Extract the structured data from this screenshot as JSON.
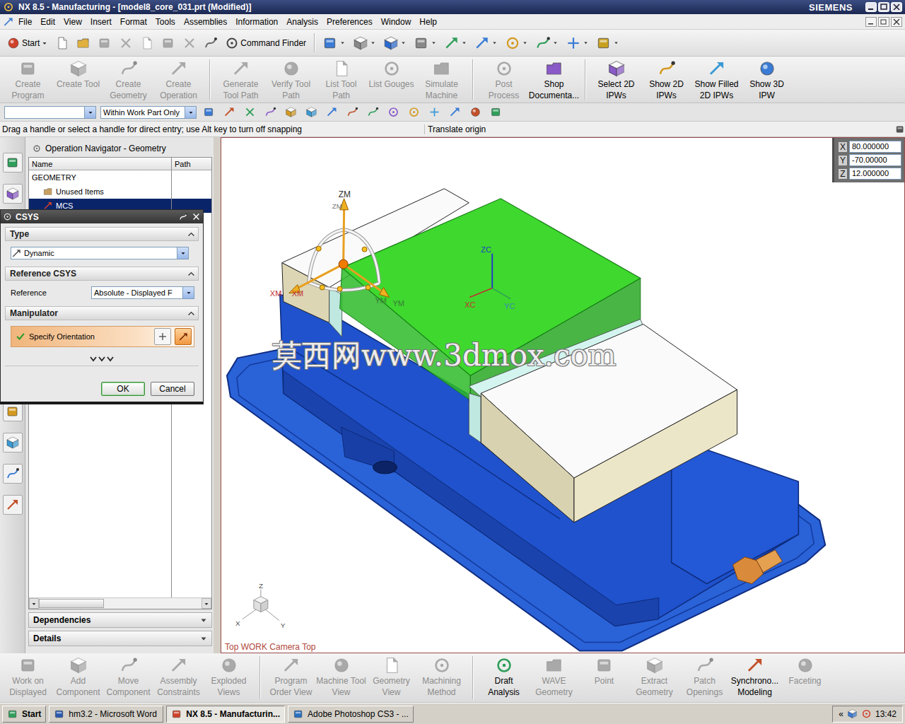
{
  "window": {
    "title": "NX 8.5 - Manufacturing - [model8_core_031.prt (Modified)]",
    "brand": "SIEMENS"
  },
  "menu": [
    "File",
    "Edit",
    "View",
    "Insert",
    "Format",
    "Tools",
    "Assemblies",
    "Information",
    "Analysis",
    "Preferences",
    "Window",
    "Help"
  ],
  "standard_toolbar": {
    "start": "Start",
    "command_finder": "Command Finder"
  },
  "operations_toolbar": [
    [
      {
        "lines": [
          "Create",
          "Program"
        ],
        "disabled": true
      },
      {
        "lines": [
          "Create Tool"
        ],
        "disabled": true
      },
      {
        "lines": [
          "Create",
          "Geometry"
        ],
        "disabled": true
      },
      {
        "lines": [
          "Create",
          "Operation"
        ],
        "disabled": true
      }
    ],
    [
      {
        "lines": [
          "Generate",
          "Tool Path"
        ],
        "disabled": true
      },
      {
        "lines": [
          "Verify Tool",
          "Path"
        ],
        "disabled": true
      },
      {
        "lines": [
          "List Tool",
          "Path"
        ],
        "disabled": true
      },
      {
        "lines": [
          "List Gouges"
        ],
        "disabled": true
      },
      {
        "lines": [
          "Simulate",
          "Machine"
        ],
        "disabled": true
      }
    ],
    [
      {
        "lines": [
          "Post",
          "Process"
        ],
        "disabled": true
      },
      {
        "lines": [
          "Shop",
          "Documenta..."
        ],
        "disabled": false
      }
    ],
    [
      {
        "lines": [
          "Select 2D",
          "IPWs"
        ],
        "disabled": false
      },
      {
        "lines": [
          "Show 2D",
          "IPWs"
        ],
        "disabled": false
      },
      {
        "lines": [
          "Show Filled",
          "2D IPWs"
        ],
        "disabled": false
      },
      {
        "lines": [
          "Show 3D",
          "IPW"
        ],
        "disabled": false
      }
    ]
  ],
  "selection_bar": {
    "type_filter": "",
    "scope": "Within Work Part Only"
  },
  "cue_line": {
    "prompt": "Drag a handle or select a handle for direct entry; use Alt key to turn off snapping",
    "status": "Translate origin"
  },
  "navigator": {
    "title": "Operation Navigator - Geometry",
    "columns": [
      "Name",
      "Path"
    ],
    "rows": [
      {
        "name": "GEOMETRY",
        "depth": 0,
        "selected": false
      },
      {
        "name": "Unused Items",
        "depth": 1,
        "selected": false
      },
      {
        "name": "MCS",
        "depth": 1,
        "selected": true
      }
    ],
    "panels": [
      {
        "label": "Dependencies",
        "expanded": false
      },
      {
        "label": "Details",
        "expanded": false
      }
    ]
  },
  "csys_dialog": {
    "title": "CSYS",
    "type_section": "Type",
    "type_value": "Dynamic",
    "reference_section": "Reference CSYS",
    "reference_label": "Reference",
    "reference_value": "Absolute - Displayed F",
    "manipulator_section": "Manipulator",
    "orientation_label": "Specify Orientation",
    "orientation_done": true,
    "ok": "OK",
    "cancel": "Cancel"
  },
  "viewport": {
    "coordinates": [
      {
        "axis": "X",
        "value": "80.000000"
      },
      {
        "axis": "Y",
        "value": "-70.00000"
      },
      {
        "axis": "Z",
        "value": "12.000000"
      }
    ],
    "manipulator": {
      "z": [
        "ZM",
        "ZM"
      ],
      "x": [
        "XM",
        "XM"
      ],
      "y": [
        "YM",
        "YM"
      ]
    },
    "work_csys": {
      "z": "ZC",
      "x": "XC",
      "y": "YC"
    },
    "view_triad": {
      "z": "Z",
      "x": "X",
      "y": "Y"
    },
    "view_label": "Top WORK Camera Top",
    "watermark": "莫西网www.3dmox.com"
  },
  "assembly_toolbar": [
    [
      {
        "lines": [
          "Work on",
          "Displayed"
        ],
        "disabled": true
      },
      {
        "lines": [
          "Add",
          "Component"
        ],
        "disabled": true
      },
      {
        "lines": [
          "Move",
          "Component"
        ],
        "disabled": true
      },
      {
        "lines": [
          "Assembly",
          "Constraints"
        ],
        "disabled": true
      },
      {
        "lines": [
          "Exploded",
          "Views"
        ],
        "disabled": true
      }
    ],
    [
      {
        "lines": [
          "Program",
          "Order View"
        ],
        "disabled": true
      },
      {
        "lines": [
          "Machine Tool",
          "View"
        ],
        "disabled": true
      },
      {
        "lines": [
          "Geometry",
          "View"
        ],
        "disabled": true
      },
      {
        "lines": [
          "Machining",
          "Method"
        ],
        "disabled": true
      }
    ],
    [
      {
        "lines": [
          "Draft",
          "Analysis"
        ],
        "disabled": false
      },
      {
        "lines": [
          "WAVE",
          "Geometry"
        ],
        "disabled": true
      },
      {
        "lines": [
          "Point"
        ],
        "disabled": true
      },
      {
        "lines": [
          "Extract",
          "Geometry"
        ],
        "disabled": true
      },
      {
        "lines": [
          "Patch",
          "Openings"
        ],
        "disabled": true
      },
      {
        "lines": [
          "Synchrono...",
          "Modeling"
        ],
        "disabled": false
      },
      {
        "lines": [
          "Faceting"
        ],
        "disabled": true
      }
    ]
  ],
  "taskbar": {
    "start": "Start",
    "tasks": [
      {
        "label": "hm3.2 - Microsoft Word",
        "selected": false
      },
      {
        "label": "NX 8.5 - Manufacturin...",
        "selected": true
      },
      {
        "label": "Adobe Photoshop CS3 - ...",
        "selected": false
      }
    ],
    "tray_toggle": "«",
    "clock": "13:42"
  }
}
